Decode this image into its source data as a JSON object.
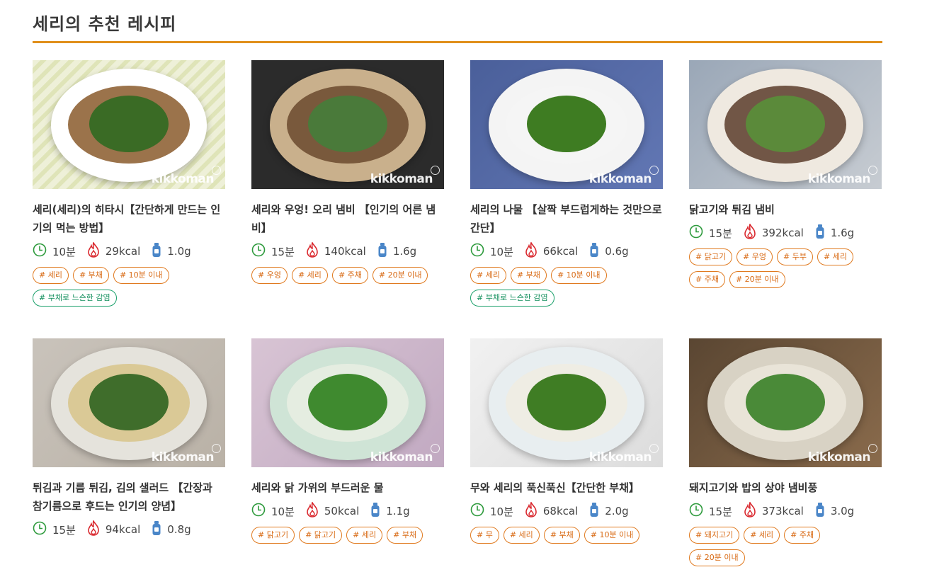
{
  "section": {
    "title": "세리의 추천 레시피"
  },
  "brand": "kikkoman",
  "colors": {
    "accent": "#e08f1b",
    "tag_orange": "#e07a1f",
    "tag_green": "#1aa06a",
    "time_icon": "#2d9a3c",
    "kcal_icon": "#d9262c",
    "salt_icon": "#4a86c8"
  },
  "recipes": [
    {
      "title": "세리(세리)의 히타시【간단하게 만드는 인기의 먹는 방법】",
      "time": "10분",
      "kcal": "29kcal",
      "salt": "1.0g",
      "tags": [
        "# 세리",
        "# 부채",
        "# 10분 이내"
      ],
      "green_tags": [
        "# 부채로 느슨한 감염"
      ]
    },
    {
      "title": "세리와 우엉! 오리 냄비 【인기의 어른 냄비】",
      "time": "15분",
      "kcal": "140kcal",
      "salt": "1.6g",
      "tags": [
        "# 우엉",
        "# 세리",
        "# 주채",
        "# 20분 이내"
      ],
      "green_tags": []
    },
    {
      "title": "세리의 나물 【살짝 부드럽게하는 것만으로 간단】",
      "time": "10분",
      "kcal": "66kcal",
      "salt": "0.6g",
      "tags": [
        "# 세리",
        "# 부채",
        "# 10분 이내"
      ],
      "green_tags": [
        "# 부채로 느슨한 감염"
      ]
    },
    {
      "title": "닭고기와 튀김 냄비",
      "time": "15분",
      "kcal": "392kcal",
      "salt": "1.6g",
      "tags": [
        "# 닭고기",
        "# 우엉",
        "# 두부",
        "# 세리",
        "# 주채",
        "# 20분 이내"
      ],
      "green_tags": []
    },
    {
      "title": "튀김과 기름 튀김, 김의 샐러드 【간장과 참기름으로 후드는 인기의 양념】",
      "time": "15분",
      "kcal": "94kcal",
      "salt": "0.8g",
      "tags": [],
      "green_tags": []
    },
    {
      "title": "세리와 닭 가위의 부드러운 물",
      "time": "10분",
      "kcal": "50kcal",
      "salt": "1.1g",
      "tags": [
        "# 닭고기",
        "# 닭고기",
        "# 세리",
        "# 부채"
      ],
      "green_tags": []
    },
    {
      "title": "무와 세리의 푹신푹신【간단한 부채】",
      "time": "10분",
      "kcal": "68kcal",
      "salt": "2.0g",
      "tags": [
        "# 무",
        "# 세리",
        "# 부채",
        "# 10분 이내"
      ],
      "green_tags": []
    },
    {
      "title": "돼지고기와 밥의 상야 냄비풍",
      "time": "15분",
      "kcal": "373kcal",
      "salt": "3.0g",
      "tags": [
        "# 돼지고기",
        "# 세리",
        "# 주채",
        "# 20분 이내"
      ],
      "green_tags": []
    }
  ]
}
